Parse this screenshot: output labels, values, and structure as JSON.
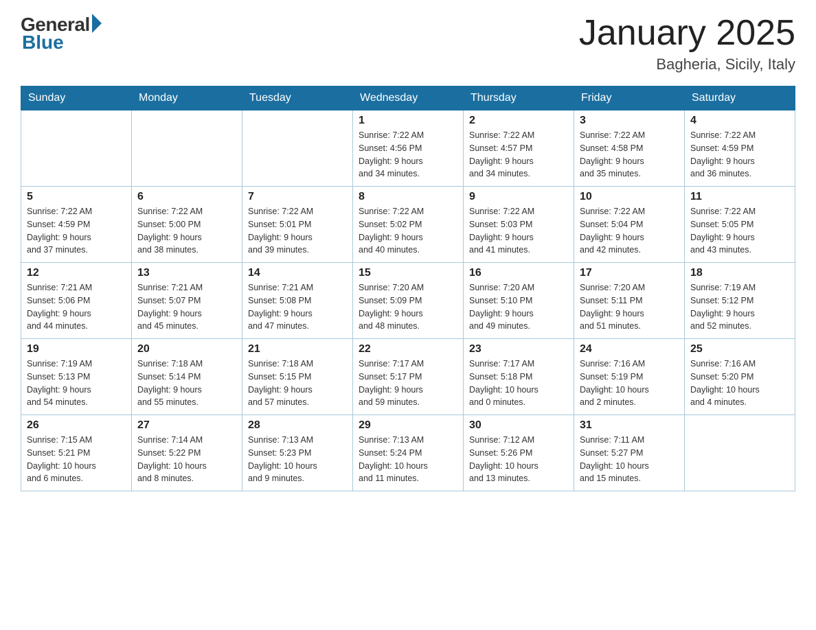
{
  "header": {
    "logo_general": "General",
    "logo_blue": "Blue",
    "month_title": "January 2025",
    "location": "Bagheria, Sicily, Italy"
  },
  "days_of_week": [
    "Sunday",
    "Monday",
    "Tuesday",
    "Wednesday",
    "Thursday",
    "Friday",
    "Saturday"
  ],
  "weeks": [
    [
      {
        "day": "",
        "info": ""
      },
      {
        "day": "",
        "info": ""
      },
      {
        "day": "",
        "info": ""
      },
      {
        "day": "1",
        "info": "Sunrise: 7:22 AM\nSunset: 4:56 PM\nDaylight: 9 hours\nand 34 minutes."
      },
      {
        "day": "2",
        "info": "Sunrise: 7:22 AM\nSunset: 4:57 PM\nDaylight: 9 hours\nand 34 minutes."
      },
      {
        "day": "3",
        "info": "Sunrise: 7:22 AM\nSunset: 4:58 PM\nDaylight: 9 hours\nand 35 minutes."
      },
      {
        "day": "4",
        "info": "Sunrise: 7:22 AM\nSunset: 4:59 PM\nDaylight: 9 hours\nand 36 minutes."
      }
    ],
    [
      {
        "day": "5",
        "info": "Sunrise: 7:22 AM\nSunset: 4:59 PM\nDaylight: 9 hours\nand 37 minutes."
      },
      {
        "day": "6",
        "info": "Sunrise: 7:22 AM\nSunset: 5:00 PM\nDaylight: 9 hours\nand 38 minutes."
      },
      {
        "day": "7",
        "info": "Sunrise: 7:22 AM\nSunset: 5:01 PM\nDaylight: 9 hours\nand 39 minutes."
      },
      {
        "day": "8",
        "info": "Sunrise: 7:22 AM\nSunset: 5:02 PM\nDaylight: 9 hours\nand 40 minutes."
      },
      {
        "day": "9",
        "info": "Sunrise: 7:22 AM\nSunset: 5:03 PM\nDaylight: 9 hours\nand 41 minutes."
      },
      {
        "day": "10",
        "info": "Sunrise: 7:22 AM\nSunset: 5:04 PM\nDaylight: 9 hours\nand 42 minutes."
      },
      {
        "day": "11",
        "info": "Sunrise: 7:22 AM\nSunset: 5:05 PM\nDaylight: 9 hours\nand 43 minutes."
      }
    ],
    [
      {
        "day": "12",
        "info": "Sunrise: 7:21 AM\nSunset: 5:06 PM\nDaylight: 9 hours\nand 44 minutes."
      },
      {
        "day": "13",
        "info": "Sunrise: 7:21 AM\nSunset: 5:07 PM\nDaylight: 9 hours\nand 45 minutes."
      },
      {
        "day": "14",
        "info": "Sunrise: 7:21 AM\nSunset: 5:08 PM\nDaylight: 9 hours\nand 47 minutes."
      },
      {
        "day": "15",
        "info": "Sunrise: 7:20 AM\nSunset: 5:09 PM\nDaylight: 9 hours\nand 48 minutes."
      },
      {
        "day": "16",
        "info": "Sunrise: 7:20 AM\nSunset: 5:10 PM\nDaylight: 9 hours\nand 49 minutes."
      },
      {
        "day": "17",
        "info": "Sunrise: 7:20 AM\nSunset: 5:11 PM\nDaylight: 9 hours\nand 51 minutes."
      },
      {
        "day": "18",
        "info": "Sunrise: 7:19 AM\nSunset: 5:12 PM\nDaylight: 9 hours\nand 52 minutes."
      }
    ],
    [
      {
        "day": "19",
        "info": "Sunrise: 7:19 AM\nSunset: 5:13 PM\nDaylight: 9 hours\nand 54 minutes."
      },
      {
        "day": "20",
        "info": "Sunrise: 7:18 AM\nSunset: 5:14 PM\nDaylight: 9 hours\nand 55 minutes."
      },
      {
        "day": "21",
        "info": "Sunrise: 7:18 AM\nSunset: 5:15 PM\nDaylight: 9 hours\nand 57 minutes."
      },
      {
        "day": "22",
        "info": "Sunrise: 7:17 AM\nSunset: 5:17 PM\nDaylight: 9 hours\nand 59 minutes."
      },
      {
        "day": "23",
        "info": "Sunrise: 7:17 AM\nSunset: 5:18 PM\nDaylight: 10 hours\nand 0 minutes."
      },
      {
        "day": "24",
        "info": "Sunrise: 7:16 AM\nSunset: 5:19 PM\nDaylight: 10 hours\nand 2 minutes."
      },
      {
        "day": "25",
        "info": "Sunrise: 7:16 AM\nSunset: 5:20 PM\nDaylight: 10 hours\nand 4 minutes."
      }
    ],
    [
      {
        "day": "26",
        "info": "Sunrise: 7:15 AM\nSunset: 5:21 PM\nDaylight: 10 hours\nand 6 minutes."
      },
      {
        "day": "27",
        "info": "Sunrise: 7:14 AM\nSunset: 5:22 PM\nDaylight: 10 hours\nand 8 minutes."
      },
      {
        "day": "28",
        "info": "Sunrise: 7:13 AM\nSunset: 5:23 PM\nDaylight: 10 hours\nand 9 minutes."
      },
      {
        "day": "29",
        "info": "Sunrise: 7:13 AM\nSunset: 5:24 PM\nDaylight: 10 hours\nand 11 minutes."
      },
      {
        "day": "30",
        "info": "Sunrise: 7:12 AM\nSunset: 5:26 PM\nDaylight: 10 hours\nand 13 minutes."
      },
      {
        "day": "31",
        "info": "Sunrise: 7:11 AM\nSunset: 5:27 PM\nDaylight: 10 hours\nand 15 minutes."
      },
      {
        "day": "",
        "info": ""
      }
    ]
  ]
}
